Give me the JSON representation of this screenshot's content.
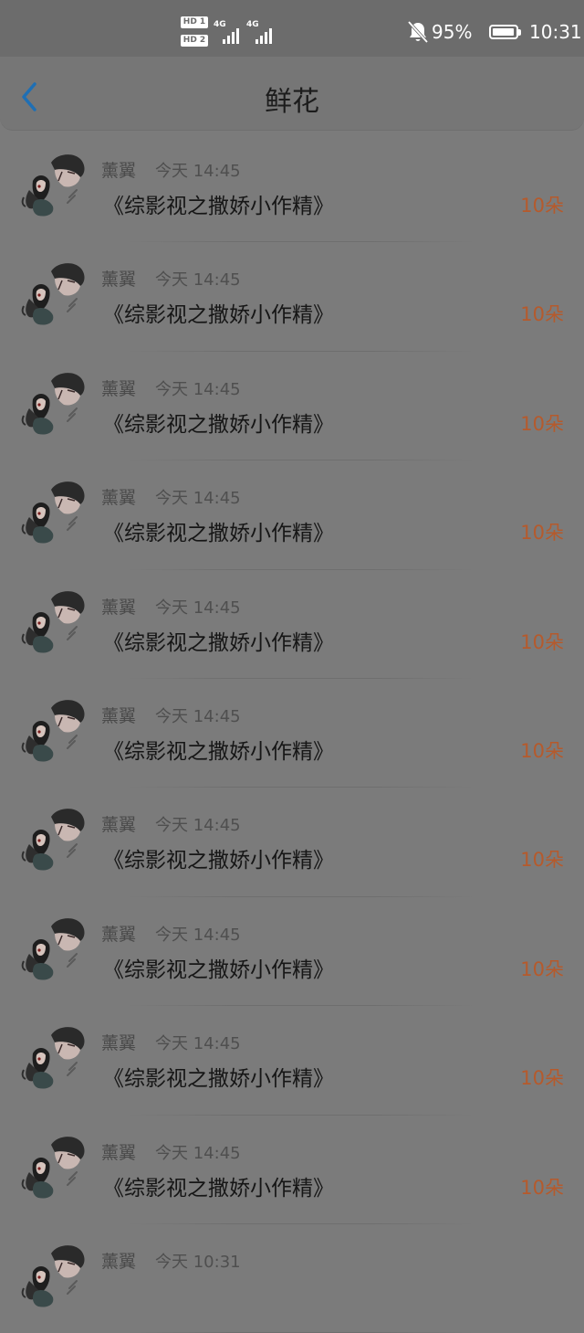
{
  "status_bar": {
    "sim1_badge": "HD 1",
    "sim2_badge": "HD 2",
    "sim1_network": "4G",
    "sim2_network": "4G",
    "battery_percent": "95%",
    "battery_level": 0.95,
    "time": "10:31",
    "icons": [
      "bell-muted-icon",
      "signal-icon",
      "battery-charging-icon"
    ]
  },
  "header": {
    "title": "鲜花",
    "back_icon": "chevron-left-icon",
    "accent_color": "#1f6fb4"
  },
  "colors": {
    "flower_count": "#b55a2c"
  },
  "list": {
    "items": [
      {
        "user": "薰翼",
        "time": "今天 14:45",
        "title": "《综影视之撒娇小作精》",
        "count": "10朵"
      },
      {
        "user": "薰翼",
        "time": "今天 14:45",
        "title": "《综影视之撒娇小作精》",
        "count": "10朵"
      },
      {
        "user": "薰翼",
        "time": "今天 14:45",
        "title": "《综影视之撒娇小作精》",
        "count": "10朵"
      },
      {
        "user": "薰翼",
        "time": "今天 14:45",
        "title": "《综影视之撒娇小作精》",
        "count": "10朵"
      },
      {
        "user": "薰翼",
        "time": "今天 14:45",
        "title": "《综影视之撒娇小作精》",
        "count": "10朵"
      },
      {
        "user": "薰翼",
        "time": "今天 14:45",
        "title": "《综影视之撒娇小作精》",
        "count": "10朵"
      },
      {
        "user": "薰翼",
        "time": "今天 14:45",
        "title": "《综影视之撒娇小作精》",
        "count": "10朵"
      },
      {
        "user": "薰翼",
        "time": "今天 14:45",
        "title": "《综影视之撒娇小作精》",
        "count": "10朵"
      },
      {
        "user": "薰翼",
        "time": "今天 14:45",
        "title": "《综影视之撒娇小作精》",
        "count": "10朵"
      },
      {
        "user": "薰翼",
        "time": "今天 14:45",
        "title": "《综影视之撒娇小作精》",
        "count": "10朵"
      },
      {
        "user": "薰翼",
        "time": "今天 10:31",
        "title": "",
        "count": ""
      }
    ]
  }
}
